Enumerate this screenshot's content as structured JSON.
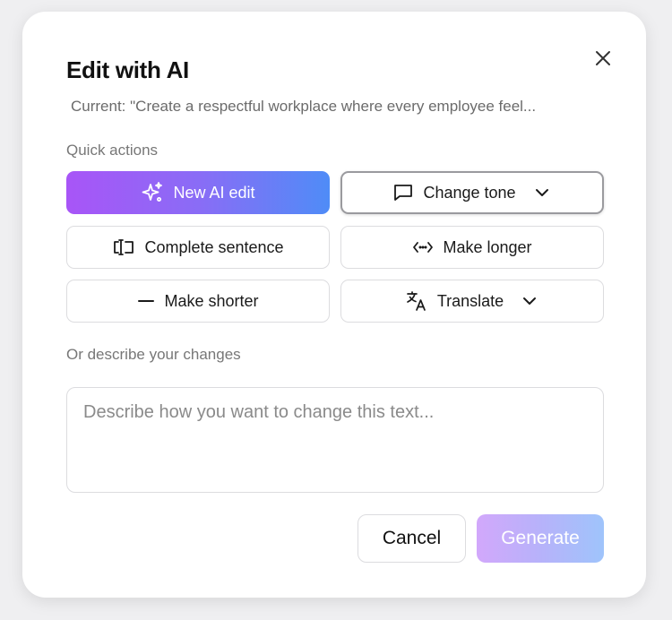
{
  "dialog": {
    "title": "Edit with AI",
    "current_text": "Current: \"Create a respectful workplace where every employee feel...",
    "close_icon": "close-icon"
  },
  "quick_actions": {
    "label": "Quick actions",
    "buttons": [
      {
        "label": "New AI edit",
        "icon": "sparkles-icon",
        "primary": true
      },
      {
        "label": "Change tone",
        "icon": "speech-bubble-icon",
        "dropdown": true
      },
      {
        "label": "Complete sentence",
        "icon": "text-cursor-icon"
      },
      {
        "label": "Make longer",
        "icon": "expand-horizontal-icon"
      },
      {
        "label": "Make shorter",
        "icon": "minus-icon"
      },
      {
        "label": "Translate",
        "icon": "translate-icon",
        "dropdown": true
      }
    ]
  },
  "describe": {
    "label": "Or describe your changes",
    "placeholder": "Describe how you want to change this text...",
    "value": ""
  },
  "footer": {
    "cancel_label": "Cancel",
    "generate_label": "Generate"
  },
  "colors": {
    "primary_gradient_start": "#a855f7",
    "primary_gradient_end": "#4f8cf7",
    "generate_disabled_start": "#d2a8fb",
    "generate_disabled_end": "#9fc4fb"
  }
}
